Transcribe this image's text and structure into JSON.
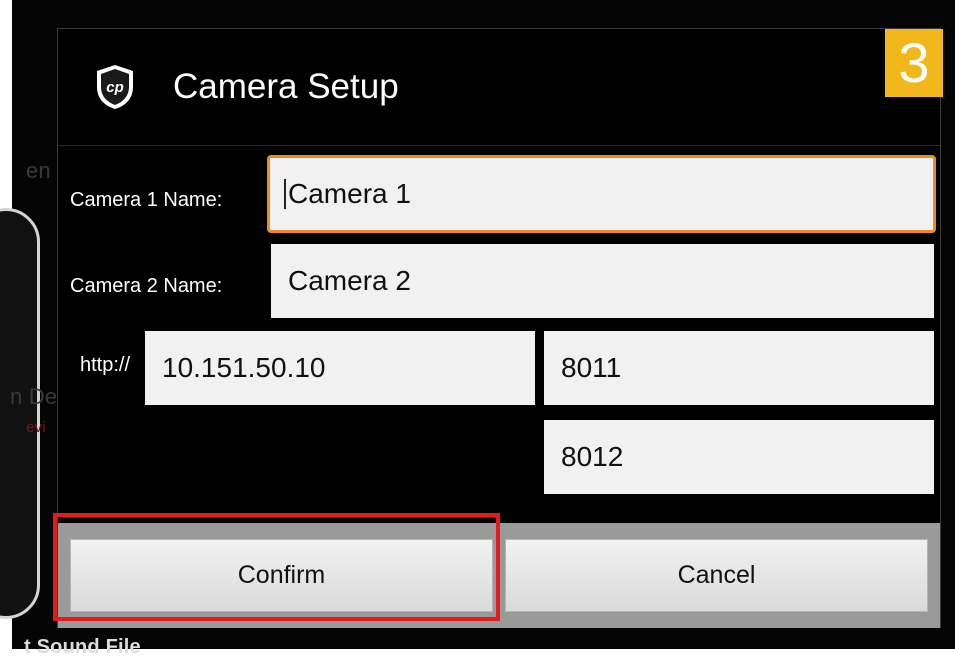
{
  "background": {
    "text_motion": "en Motion Detected",
    "text_detected": "n Detected",
    "text_red": "evi",
    "text_bottom": "t Sound File"
  },
  "dialog": {
    "title": "Camera Setup",
    "step_badge": "3",
    "camera1_label": "Camera 1 Name:",
    "camera1_value": "Camera 1",
    "camera2_label": "Camera 2 Name:",
    "camera2_value": "Camera 2",
    "http_label": "http://",
    "ip_value": "10.151.50.10",
    "port1_value": "8011",
    "port2_value": "8012",
    "confirm_label": "Confirm",
    "cancel_label": "Cancel"
  },
  "colors": {
    "focus_border": "#f08a1e",
    "badge": "#f2b81b",
    "highlight": "#e41b1b"
  }
}
